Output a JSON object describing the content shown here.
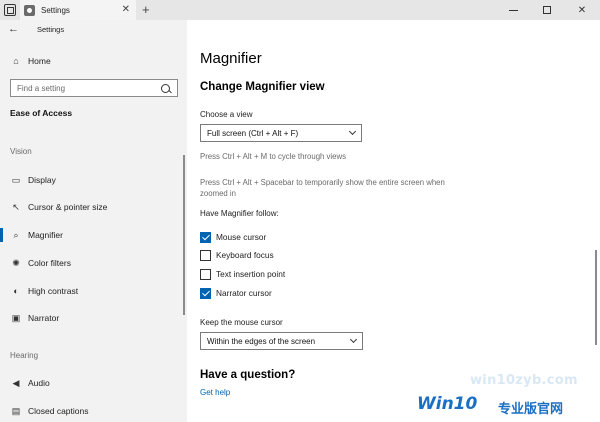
{
  "tab": {
    "title": "Settings",
    "close_glyph": "✕",
    "new_glyph": "+"
  },
  "window": {
    "max_glyph": "",
    "close_glyph": "✕"
  },
  "sidebar": {
    "back_glyph": "←",
    "title": "Settings",
    "home": {
      "icon": "home-icon",
      "glyph": "⌂",
      "label": "Home"
    },
    "search": {
      "placeholder": "Find a setting",
      "icon": "search-icon"
    },
    "section": "Ease of Access",
    "groups": {
      "vision": "Vision",
      "hearing": "Hearing"
    },
    "items": [
      {
        "id": "display",
        "icon": "display-icon",
        "glyph": "▭",
        "label": "Display"
      },
      {
        "id": "cursor",
        "icon": "pointer-icon",
        "glyph": "↖",
        "label": "Cursor & pointer size"
      },
      {
        "id": "magnifier",
        "icon": "magnifier-icon",
        "glyph": "⌕",
        "label": "Magnifier",
        "active": true
      },
      {
        "id": "color-filters",
        "icon": "color-filters-icon",
        "glyph": "✺",
        "label": "Color filters"
      },
      {
        "id": "high-contrast",
        "icon": "contrast-icon",
        "glyph": "◐",
        "label": "High contrast"
      },
      {
        "id": "narrator",
        "icon": "narrator-icon",
        "glyph": "▣",
        "label": "Narrator"
      },
      {
        "id": "audio",
        "icon": "speaker-icon",
        "glyph": "◀",
        "label": "Audio"
      },
      {
        "id": "closed-captions",
        "icon": "captions-icon",
        "glyph": "▤",
        "label": "Closed captions"
      }
    ]
  },
  "main": {
    "title": "Magnifier",
    "subheading": "Change Magnifier view",
    "view": {
      "label": "Choose a view",
      "selected": "Full screen (Ctrl + Alt + F)"
    },
    "hint1": "Press Ctrl + Alt + M to cycle through views",
    "hint2": "Press Ctrl + Alt + Spacebar to temporarily show the entire screen when zoomed in",
    "follow": {
      "label": "Have Magnifier follow:",
      "options": [
        {
          "label": "Mouse cursor",
          "checked": true
        },
        {
          "label": "Keyboard focus",
          "checked": false
        },
        {
          "label": "Text insertion point",
          "checked": false
        },
        {
          "label": "Narrator cursor",
          "checked": true
        }
      ]
    },
    "mouse": {
      "label": "Keep the mouse cursor",
      "selected": "Within the edges of the screen"
    },
    "question": "Have a question?",
    "help_link": "Get help"
  },
  "watermark": {
    "url": "win10zyb.com",
    "logo": "Win10",
    "cn": "专业版官网"
  },
  "colors": {
    "accent": "#0063b1",
    "sidebar_bg": "#f2f2f2",
    "watermark": "#1a6fc4"
  }
}
